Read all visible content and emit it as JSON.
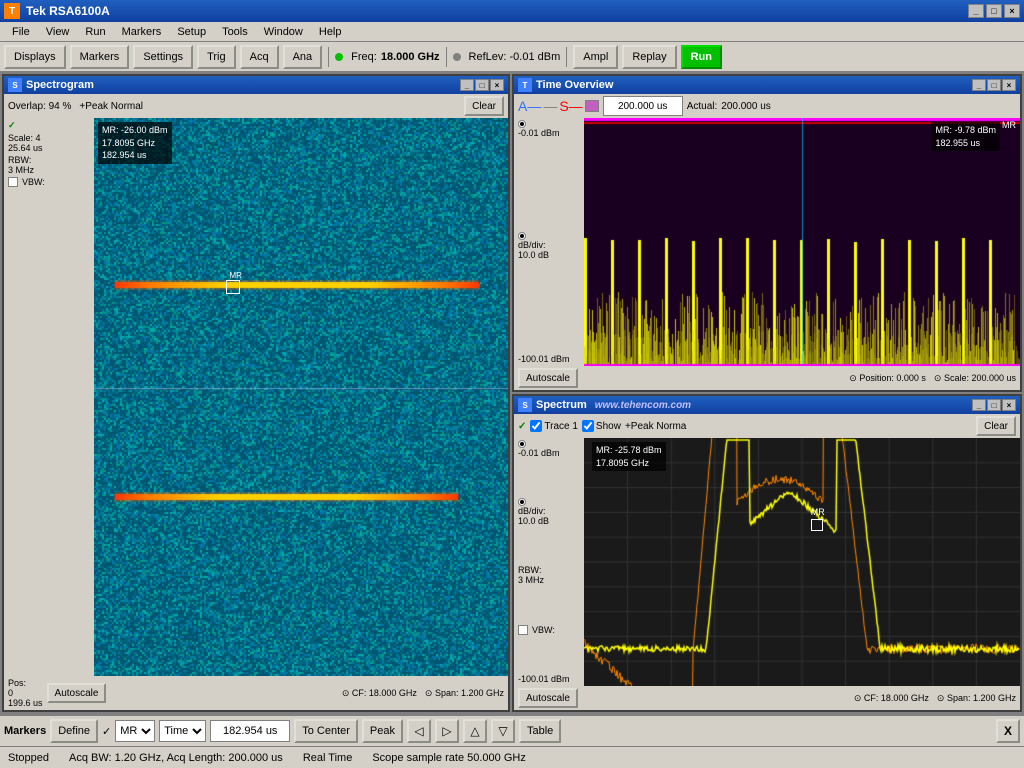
{
  "app": {
    "title": "Tek RSA6100A",
    "title_icon": "T"
  },
  "menu": {
    "items": [
      "File",
      "View",
      "Run",
      "Markers",
      "Setup",
      "Tools",
      "Window",
      "Help"
    ]
  },
  "toolbar": {
    "displays_label": "Displays",
    "markers_label": "Markers",
    "settings_label": "Settings",
    "trig_label": "Trig",
    "acq_label": "Acq",
    "ana_label": "Ana",
    "freq_label": "Freq:",
    "freq_value": "18.000 GHz",
    "reflev_label": "RefLev: -0.01 dBm",
    "ampl_label": "Ampl",
    "replay_label": "Replay",
    "run_label": "Run"
  },
  "spectrogram": {
    "title": "Spectrogram",
    "overlap_label": "Overlap: 94 %",
    "peak_label": "+Peak Normal",
    "clear_label": "Clear",
    "scale_label": "Scale: 4",
    "time1_label": "25.64 us",
    "rbw_label": "RBW:",
    "rbw_val": "3 MHz",
    "vbw_label": "VBW:",
    "marker_readout": "MR: -26.00 dBm\n17.8095 GHz\n182.954 us",
    "autoscale_label": "Autoscale",
    "cf_label": "CF: 18.000 GHz",
    "span_label": "Span: 1.200 GHz",
    "pos_label": "Pos:",
    "pos_val": "0",
    "pos_time": "199.6 us",
    "line1_top": "30%",
    "line2_top": "68%"
  },
  "time_overview": {
    "title": "Time Overview",
    "time_input": "200.000 us",
    "actual_label": "Actual:",
    "actual_value": "200.000 us",
    "ref_label": "-0.01 dBm",
    "dbdiv_label": "dB/div:",
    "dbdiv_val": "10.0 dB",
    "bottom_label": "-100.01 dBm",
    "autoscale_label": "Autoscale",
    "position_label": "Position: 0.000 s",
    "scale_label": "Scale: 200.000 us",
    "marker_readout": "MR: -9.78 dBm\n182.955 us"
  },
  "spectrum": {
    "title": "Spectrum",
    "trace_label": "Trace 1",
    "show_label": "Show",
    "peak_label": "+Peak Norma",
    "clear_label": "Clear",
    "ref_label": "-0.01 dBm",
    "dbdiv_label": "dB/div:",
    "dbdiv_val": "10.0 dB",
    "rbw_label": "RBW:",
    "rbw_val": "3 MHz",
    "vbw_label": "VBW:",
    "bottom_label": "-100.01 dBm",
    "autoscale_label": "Autoscale",
    "cf_label": "CF: 18.000 GHz",
    "span_label": "Span: 1.200 GHz",
    "marker_readout": "MR: -25.78 dBm\n17.8095 GHz"
  },
  "marker_bar": {
    "markers_label": "Markers",
    "define_label": "Define",
    "mr_label": "MR",
    "time_option": "Time",
    "time_value": "182.954 us",
    "to_center_label": "To Center",
    "peak_label": "Peak",
    "table_label": "Table",
    "x_label": "X"
  },
  "trace_label": "Trace",
  "status_bar": {
    "status": "Stopped",
    "acq_bw": "Acq BW: 1.20 GHz, Acq Length: 200.000 us",
    "real_time": "Real Time",
    "scope_rate": "Scope sample rate 50.000 GHz"
  },
  "colors": {
    "title_bar_start": "#2060c0",
    "title_bar_end": "#1040a0",
    "spectrogram_bg": "#006080",
    "time_bg": "#1a0020",
    "spectrum_bg": "#1a1a1a",
    "accent_green": "#00c000"
  }
}
